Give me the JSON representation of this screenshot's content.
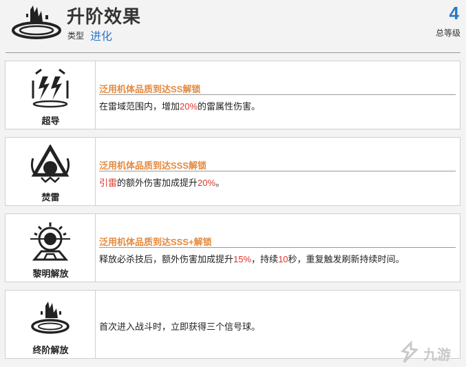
{
  "header": {
    "title": "升阶效果",
    "type_label": "类型",
    "type_value": "进化",
    "level_value": "4",
    "level_label": "总等级"
  },
  "cards": [
    {
      "name": "超导",
      "icon": "lightning-icon",
      "unlock": "泛用机体品质到达SS解锁",
      "desc": [
        {
          "t": "在雷域范围内，增加"
        },
        {
          "t": "20%",
          "hl": true
        },
        {
          "t": "的雷属性伤害。"
        }
      ]
    },
    {
      "name": "焚雷",
      "icon": "thunder-orb-icon",
      "unlock": "泛用机体品质到达SSS解锁",
      "desc": [
        {
          "t": "引雷",
          "hl": true
        },
        {
          "t": "的额外伤害加成提升"
        },
        {
          "t": "20%",
          "hl": true
        },
        {
          "t": "。"
        }
      ]
    },
    {
      "name": "黎明解放",
      "icon": "sun-eye-icon",
      "unlock": "泛用机体品质到达SSS+解锁",
      "desc": [
        {
          "t": "释放必杀技后，额外伤害加成提升"
        },
        {
          "t": "15%",
          "hl": true
        },
        {
          "t": "，持续"
        },
        {
          "t": "10",
          "hl": true
        },
        {
          "t": "秒，重复触发刷新持续时间。"
        }
      ]
    },
    {
      "name": "终阶解放",
      "icon": "final-release-icon",
      "unlock": "",
      "desc": [
        {
          "t": "首次进入战斗时，立即获得三个信号球。"
        }
      ]
    }
  ],
  "watermark": {
    "text": "九游",
    "logo_icon": "jiuyou-logo-icon"
  },
  "colors": {
    "accent_blue": "#2a77c9",
    "unlock_orange": "#e6893a",
    "highlight_red": "#e0312a"
  }
}
